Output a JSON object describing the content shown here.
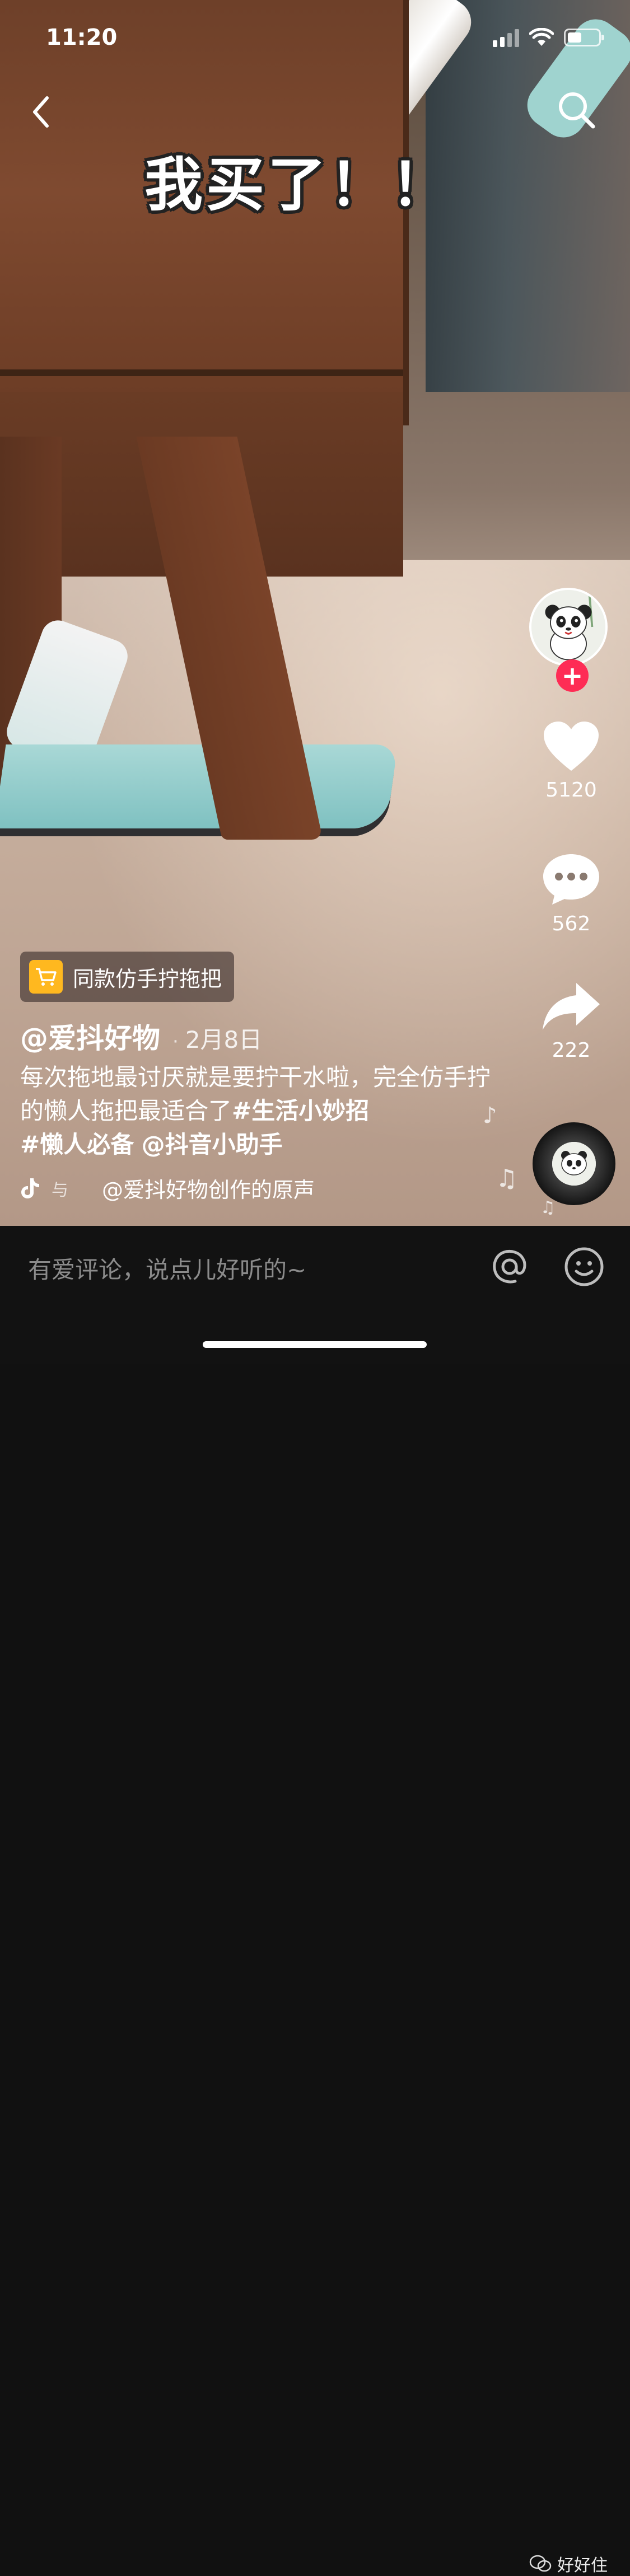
{
  "status_bar": {
    "time": "11:20"
  },
  "video": {
    "caption": "我买了！！"
  },
  "right_rail": {
    "likes": "5120",
    "comments": "562",
    "shares": "222",
    "follow_symbol": "+"
  },
  "product": {
    "label": "同款仿手拧拖把",
    "icon": "cart-icon"
  },
  "post": {
    "author": "@爱抖好物",
    "separator": "·",
    "date": "2月8日",
    "desc_text": "每次拖地最讨厌就是要拧干水啦，完全仿手拧的懒人拖把最适合了",
    "tag1": "#生活小妙招",
    "tag2": "#懒人必备",
    "mention": "@抖音小助手",
    "music_fragment": "与",
    "music": "@爱抖好物创作的原声"
  },
  "comment_bar": {
    "placeholder": "有爱评论，说点儿好听的~"
  },
  "watermark": {
    "text": "好好住"
  },
  "colors": {
    "accent_red": "#fe2c55",
    "cart_yellow": "#ffb81f",
    "bar_bg": "#121212"
  }
}
